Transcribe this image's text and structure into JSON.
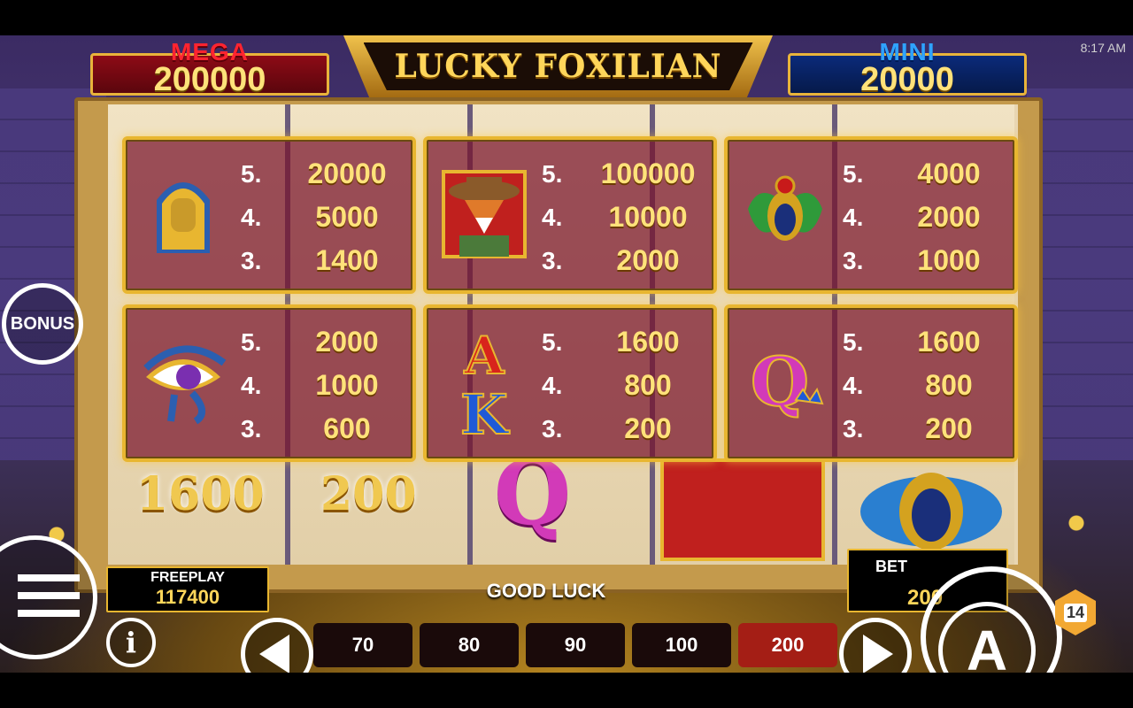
{
  "status": {
    "clock": "8:17 AM"
  },
  "jackpots": {
    "mega": {
      "label": "MEGA",
      "value": "200000"
    },
    "mini": {
      "label": "MINI",
      "value": "20000"
    }
  },
  "logo": {
    "title": "LUCKY FOXILIAN"
  },
  "paytable": [
    {
      "symbol": "pharaoh-icon",
      "rows": [
        {
          "count": "5.",
          "pay": "20000"
        },
        {
          "count": "4.",
          "pay": "5000"
        },
        {
          "count": "3.",
          "pay": "1400"
        }
      ]
    },
    {
      "symbol": "fox-icon",
      "rows": [
        {
          "count": "5.",
          "pay": "100000"
        },
        {
          "count": "4.",
          "pay": "10000"
        },
        {
          "count": "3.",
          "pay": "2000"
        }
      ]
    },
    {
      "symbol": "scarab-icon",
      "rows": [
        {
          "count": "5.",
          "pay": "4000"
        },
        {
          "count": "4.",
          "pay": "2000"
        },
        {
          "count": "3.",
          "pay": "1000"
        }
      ]
    },
    {
      "symbol": "eye-of-horus-icon",
      "rows": [
        {
          "count": "5.",
          "pay": "2000"
        },
        {
          "count": "4.",
          "pay": "1000"
        },
        {
          "count": "3.",
          "pay": "600"
        }
      ]
    },
    {
      "symbol": "ace-king-icon",
      "rows": [
        {
          "count": "5.",
          "pay": "1600"
        },
        {
          "count": "4.",
          "pay": "800"
        },
        {
          "count": "3.",
          "pay": "200"
        }
      ]
    },
    {
      "symbol": "queen-icon",
      "rows": [
        {
          "count": "5.",
          "pay": "1600"
        },
        {
          "count": "4.",
          "pay": "800"
        },
        {
          "count": "3.",
          "pay": "200"
        }
      ]
    }
  ],
  "reels_visible": {
    "col1_value": "1600",
    "col2_value": "200"
  },
  "controls": {
    "bonus_label": "BONUS",
    "freeplay_label": "FREEPLAY",
    "freeplay_value": "117400",
    "message": "GOOD LUCK",
    "bet_label": "BET",
    "bet_value": "200",
    "bet_options": [
      "70",
      "80",
      "90",
      "100",
      "200"
    ],
    "selected_bet": "200",
    "info_label": "i",
    "auto_label": "A",
    "age_rating": "14"
  },
  "colors": {
    "gold": "#e8b630",
    "selected_chip": "#a41e15",
    "mega": "#ff2430",
    "mini": "#2fa3ff"
  }
}
